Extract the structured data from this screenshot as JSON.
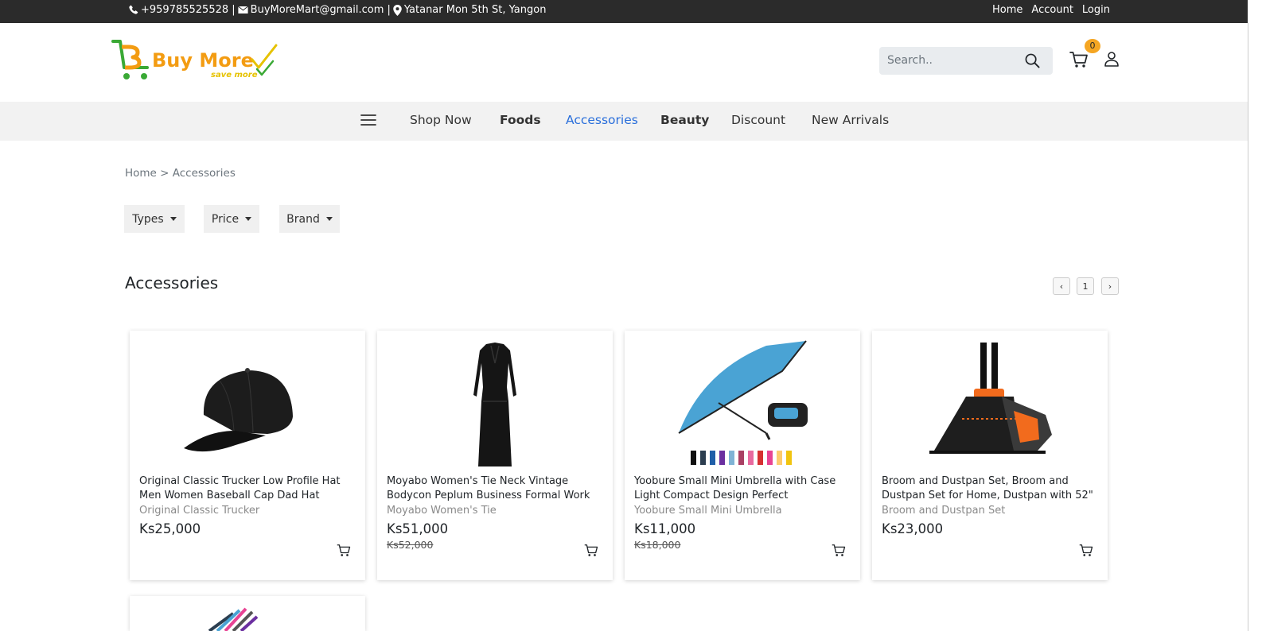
{
  "topbar": {
    "phone": "+959785525528 |",
    "email": "BuyMoreMart@gmail.com |",
    "address": "Yatanar Mon 5th St, Yangon",
    "links": [
      "Home",
      "Account",
      "Login"
    ]
  },
  "header": {
    "logo_main": "Buy More",
    "logo_sub": "save more",
    "search_placeholder": "Search..",
    "cart_count": "0"
  },
  "nav": {
    "items": [
      "Shop Now",
      "Foods",
      "Accessories",
      "Beauty",
      "Discount",
      "New Arrivals"
    ],
    "active": "Accessories"
  },
  "breadcrumb": "Home > Accessories",
  "filters": [
    "Types",
    "Price",
    "Brand"
  ],
  "section": {
    "title": "Accessories",
    "prev": "‹",
    "page": "1",
    "next": "›"
  },
  "products": [
    {
      "name": "Original Classic Trucker Low Profile Hat Men Women Baseball Cap Dad Hat",
      "subtitle": "Original Classic Trucker",
      "price": "Ks25,000",
      "old_price": ""
    },
    {
      "name": "Moyabo Women's Tie Neck Vintage Bodycon Peplum Business Formal Work",
      "subtitle": "Moyabo Women's Tie",
      "price": "Ks51,000",
      "old_price": "Ks52,000"
    },
    {
      "name": "Yoobure Small Mini Umbrella with Case Light Compact Design Perfect",
      "subtitle": "Yoobure Small Mini Umbrella",
      "price": "Ks11,000",
      "old_price": "Ks18,000"
    },
    {
      "name": "Broom and Dustpan Set, Broom and Dustpan Set for Home, Dustpan with 52\"",
      "subtitle": "Broom and Dustpan Set",
      "price": "Ks23,000",
      "old_price": ""
    }
  ],
  "colors": {
    "topbar_bg": "#2b2b2b",
    "nav_bg": "#f2f2f2",
    "active_link": "#2a6fdb",
    "badge": "#f5a623",
    "logo_green": "#3aa935",
    "logo_orange": "#f39c12"
  }
}
